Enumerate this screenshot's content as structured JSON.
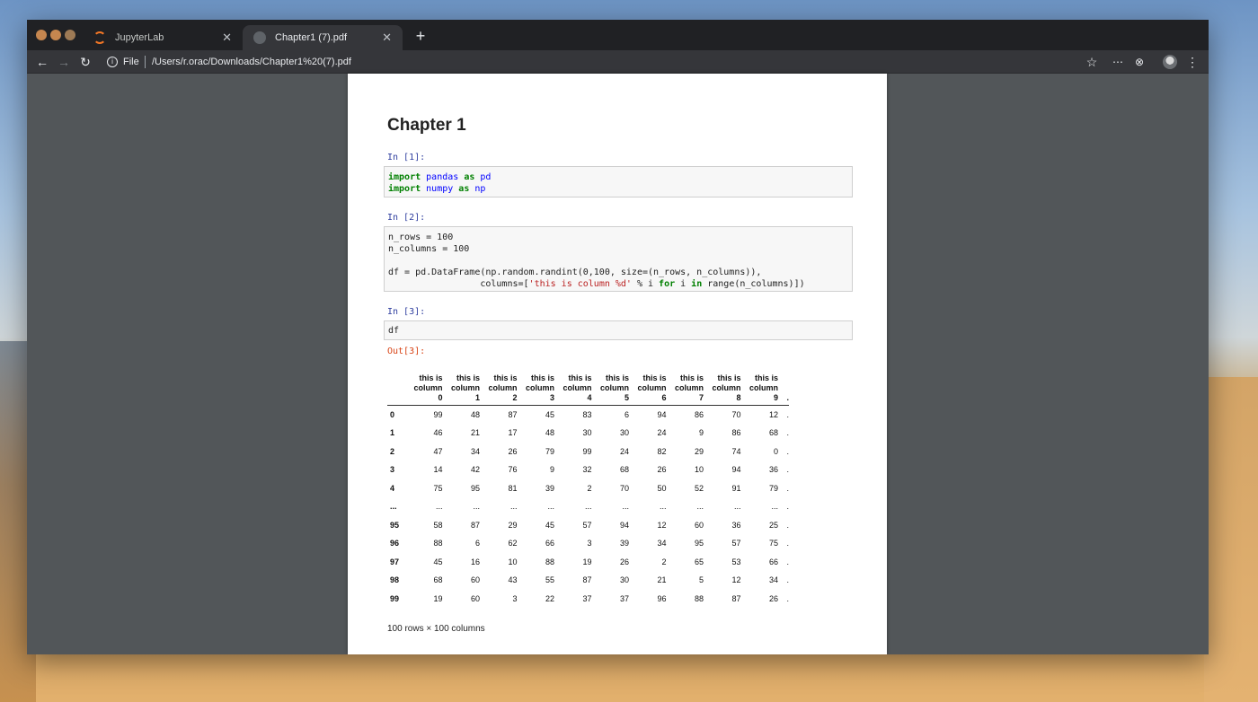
{
  "browser": {
    "tabs": [
      {
        "label": "JupyterLab",
        "active": false
      },
      {
        "label": "Chapter1 (7).pdf",
        "active": true
      }
    ],
    "new_tab": "+",
    "address": {
      "scheme": "File",
      "path": "/Users/r.orac/Downloads/Chapter1%20(7).pdf"
    },
    "icons": {
      "back": "←",
      "forward": "→",
      "reload": "↻",
      "bookmark": "☆",
      "extensions": "⋯",
      "glasses": "⊗",
      "menu": "⋮"
    }
  },
  "document": {
    "title": "Chapter 1",
    "cells": [
      {
        "prompt": "In [1]:"
      },
      {
        "prompt": "In [2]:"
      },
      {
        "prompt": "In [3]:",
        "code": "df"
      }
    ],
    "output_prompt": "Out[3]:",
    "code_lines": {
      "c1_l1_kw1": "import",
      "c1_l1_mod": "pandas",
      "c1_l1_kw2": "as",
      "c1_l1_alias": "pd",
      "c1_l2_kw1": "import",
      "c1_l2_mod": "numpy",
      "c1_l2_kw2": "as",
      "c1_l2_alias": "np",
      "c2_l1": "n_rows = 100",
      "c2_l2": "n_columns = 100",
      "c2_l4": "df = pd.DataFrame(np.random.randint(0,100, size=(n_rows, n_columns)),",
      "c2_l5_a": "                 columns=[",
      "c2_l5_str": "'this is column %d'",
      "c2_l5_b": " % i ",
      "c2_l5_for": "for",
      "c2_l5_c": " i ",
      "c2_l5_in": "in",
      "c2_l5_d": " range(n_columns)])"
    },
    "dataframe": {
      "columns": [
        "this is column 0",
        "this is column 1",
        "this is column 2",
        "this is column 3",
        "this is column 4",
        "this is column 5",
        "this is column 6",
        "this is column 7",
        "this is column 8",
        "this is column 9"
      ],
      "rows": [
        {
          "index": "0",
          "values": [
            "99",
            "48",
            "87",
            "45",
            "83",
            "6",
            "94",
            "86",
            "70",
            "12"
          ]
        },
        {
          "index": "1",
          "values": [
            "46",
            "21",
            "17",
            "48",
            "30",
            "30",
            "24",
            "9",
            "86",
            "68"
          ]
        },
        {
          "index": "2",
          "values": [
            "47",
            "34",
            "26",
            "79",
            "99",
            "24",
            "82",
            "29",
            "74",
            "0"
          ]
        },
        {
          "index": "3",
          "values": [
            "14",
            "42",
            "76",
            "9",
            "32",
            "68",
            "26",
            "10",
            "94",
            "36"
          ]
        },
        {
          "index": "4",
          "values": [
            "75",
            "95",
            "81",
            "39",
            "2",
            "70",
            "50",
            "52",
            "91",
            "79"
          ]
        },
        {
          "index": "...",
          "values": [
            "...",
            "...",
            "...",
            "...",
            "...",
            "...",
            "...",
            "...",
            "...",
            "..."
          ]
        },
        {
          "index": "95",
          "values": [
            "58",
            "87",
            "29",
            "45",
            "57",
            "94",
            "12",
            "60",
            "36",
            "25"
          ]
        },
        {
          "index": "96",
          "values": [
            "88",
            "6",
            "62",
            "66",
            "3",
            "39",
            "34",
            "95",
            "57",
            "75"
          ]
        },
        {
          "index": "97",
          "values": [
            "45",
            "16",
            "10",
            "88",
            "19",
            "26",
            "2",
            "65",
            "53",
            "66"
          ]
        },
        {
          "index": "98",
          "values": [
            "68",
            "60",
            "43",
            "55",
            "87",
            "30",
            "21",
            "5",
            "12",
            "34"
          ]
        },
        {
          "index": "99",
          "values": [
            "19",
            "60",
            "3",
            "22",
            "37",
            "37",
            "96",
            "88",
            "87",
            "26"
          ]
        }
      ],
      "ellipsis": ".",
      "shape": "100 rows × 100 columns"
    }
  }
}
